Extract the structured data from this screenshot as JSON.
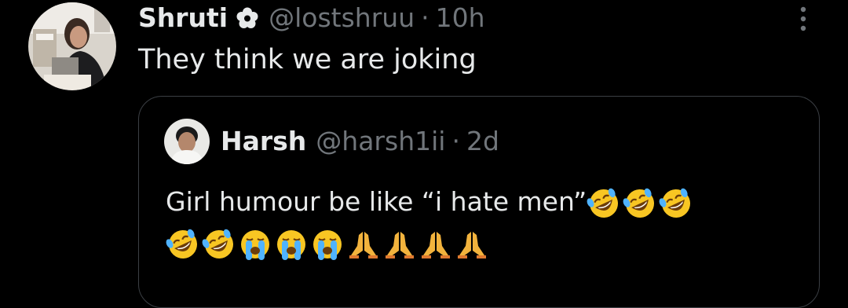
{
  "tweet": {
    "author": {
      "display_name": "Shruti",
      "badge": "flower-badge",
      "handle": "@lostshruu",
      "separator": "·",
      "time": "10h",
      "avatar": "avatar-photo"
    },
    "text": "They think we are joking",
    "menu_icon": "more-vertical-icon"
  },
  "quoted_tweet": {
    "author": {
      "display_name": "Harsh",
      "handle": "@harsh1ii",
      "separator": "·",
      "time": "2d",
      "avatar": "avatar-photo"
    },
    "text": "Girl humour be like “i hate men”",
    "emojis_line1": [
      "rofl",
      "rofl",
      "rofl"
    ],
    "emojis_line2": [
      "rofl",
      "rofl",
      "sob",
      "sob",
      "sob",
      "pray",
      "pray",
      "pray",
      "pray"
    ]
  },
  "colors": {
    "background": "#000000",
    "primary_text": "#e7e9ea",
    "secondary_text": "#71767b",
    "card_border": "#3b3f44"
  }
}
